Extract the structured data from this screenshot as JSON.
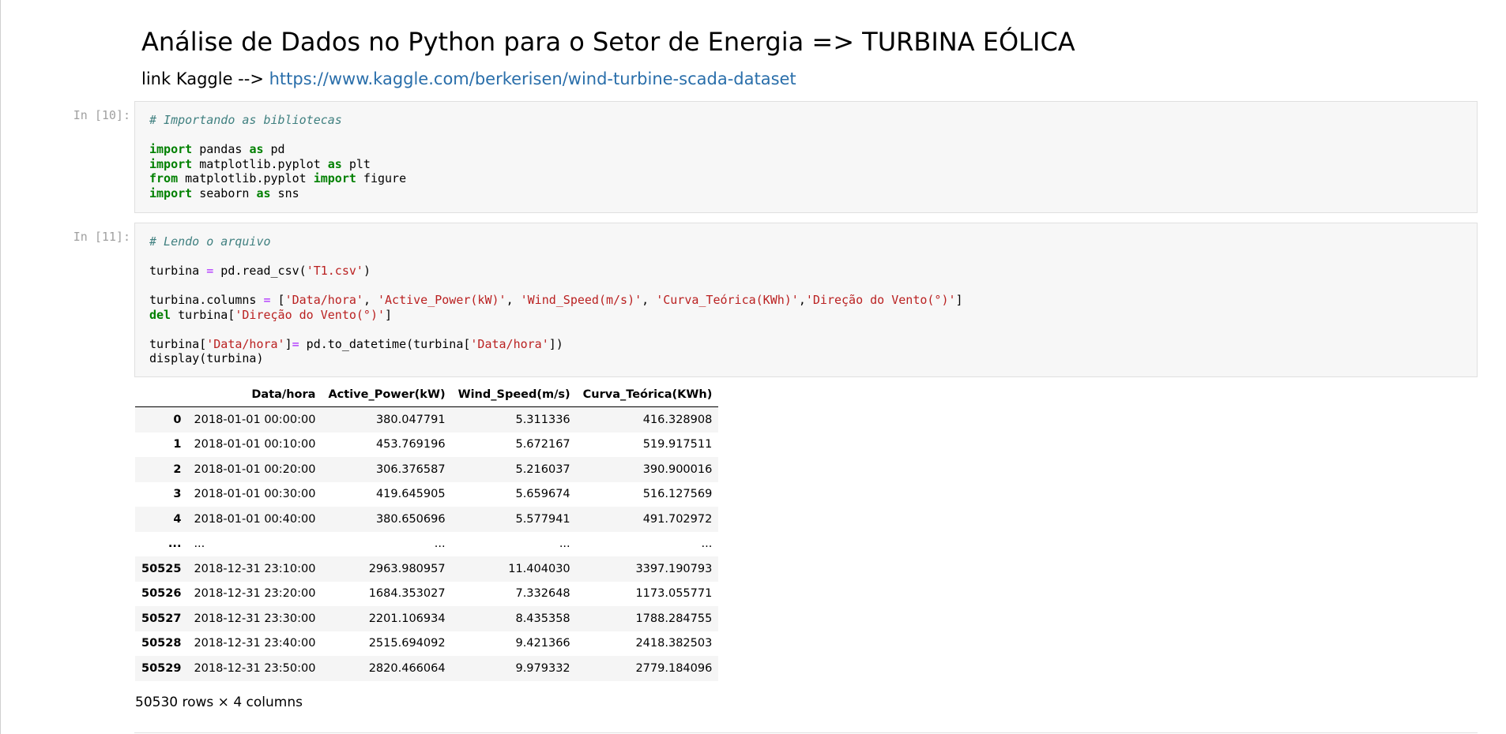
{
  "markdown": {
    "title": "Análise de Dados no Python para o Setor de Energia => TURBINA EÓLICA",
    "link_prefix": "link Kaggle --> ",
    "link_url": "https://www.kaggle.com/berkerisen/wind-turbine-scada-dataset"
  },
  "cells": [
    {
      "prompt": "In [10]:",
      "comment": "# Importando as bibliotecas",
      "lines": [
        [
          "import",
          " pandas ",
          "as",
          " pd"
        ],
        [
          "import",
          " matplotlib.pyplot ",
          "as",
          " plt"
        ],
        [
          "from",
          " matplotlib.pyplot ",
          "import",
          " figure"
        ],
        [
          "import",
          " seaborn ",
          "as",
          " sns"
        ]
      ]
    },
    {
      "prompt": "In [11]:",
      "comment": "# Lendo o arquivo",
      "read_csv": {
        "pre": "turbina ",
        "eq": "=",
        "call": " pd.read_csv(",
        "arg": "'T1.csv'",
        "close": ")"
      },
      "columns_assign": {
        "pre": "turbina.columns ",
        "eq": "=",
        "open": " [",
        "c1": "'Data/hora'",
        "c2": "'Active_Power(kW)'",
        "c3": "'Wind_Speed(m/s)'",
        "c4": "'Curva_Teórica(KWh)'",
        "c5": "'Direção do Vento(°)'",
        "sep": ", ",
        "sep_tight": ",",
        "close": "]"
      },
      "del_line": {
        "kw": "del",
        "pre": " turbina[",
        "arg": "'Direção do Vento(°)'",
        "close": "]"
      },
      "datetime_line": {
        "pre": "turbina[",
        "arg1": "'Data/hora'",
        "mid": "]",
        "eq": "=",
        "call": " pd.to_datetime(turbina[",
        "arg2": "'Data/hora'",
        "close": "])"
      },
      "display_line": "display(turbina)"
    }
  ],
  "dataframe": {
    "columns": [
      "",
      "Data/hora",
      "Active_Power(kW)",
      "Wind_Speed(m/s)",
      "Curva_Teórica(KWh)"
    ],
    "rows": [
      [
        "0",
        "2018-01-01 00:00:00",
        "380.047791",
        "5.311336",
        "416.328908"
      ],
      [
        "1",
        "2018-01-01 00:10:00",
        "453.769196",
        "5.672167",
        "519.917511"
      ],
      [
        "2",
        "2018-01-01 00:20:00",
        "306.376587",
        "5.216037",
        "390.900016"
      ],
      [
        "3",
        "2018-01-01 00:30:00",
        "419.645905",
        "5.659674",
        "516.127569"
      ],
      [
        "4",
        "2018-01-01 00:40:00",
        "380.650696",
        "5.577941",
        "491.702972"
      ],
      [
        "...",
        "...",
        "...",
        "...",
        "..."
      ],
      [
        "50525",
        "2018-12-31 23:10:00",
        "2963.980957",
        "11.404030",
        "3397.190793"
      ],
      [
        "50526",
        "2018-12-31 23:20:00",
        "1684.353027",
        "7.332648",
        "1173.055771"
      ],
      [
        "50527",
        "2018-12-31 23:30:00",
        "2201.106934",
        "8.435358",
        "1788.284755"
      ],
      [
        "50528",
        "2018-12-31 23:40:00",
        "2515.694092",
        "9.421366",
        "2418.382503"
      ],
      [
        "50529",
        "2018-12-31 23:50:00",
        "2820.466064",
        "9.979332",
        "2779.184096"
      ]
    ],
    "summary": "50530 rows × 4 columns"
  }
}
